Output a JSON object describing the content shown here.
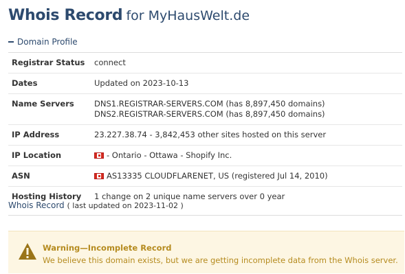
{
  "header": {
    "title": "Whois Record",
    "subtitle": "for MyHausWelt.de"
  },
  "section": {
    "toggle_label": "Domain Profile"
  },
  "profile": {
    "rows": [
      {
        "label": "Registrar Status",
        "values": [
          "connect"
        ]
      },
      {
        "label": "Dates",
        "values": [
          "Updated on 2023-10-13"
        ]
      },
      {
        "label": "Name Servers",
        "values": [
          "DNS1.REGISTRAR-SERVERS.COM (has 8,897,450 domains)",
          "DNS2.REGISTRAR-SERVERS.COM (has 8,897,450 domains)"
        ]
      },
      {
        "label": "IP Address",
        "values": [
          "23.227.38.74 - 3,842,453 other sites hosted on this server"
        ]
      },
      {
        "label": "IP Location",
        "values": [
          "- Ontario - Ottawa - Shopify Inc."
        ],
        "flag": "canada-flag-icon"
      },
      {
        "label": "ASN",
        "values": [
          "AS13335 CLOUDFLARENET, US (registered Jul 14, 2010)"
        ],
        "flag": "canada-flag-icon"
      },
      {
        "label": "Hosting History",
        "values": [
          "1 change on 2 unique name servers over 0 year"
        ]
      }
    ]
  },
  "whois": {
    "link_label": "Whois Record",
    "updated_text": "( last updated on 2023-11-02 )"
  },
  "warning": {
    "icon": "warning-triangle-icon",
    "title": "Warning—Incomplete Record",
    "text": "We believe this domain exists, but we are getting incomplete data from the Whois server."
  },
  "colors": {
    "heading": "#2d4a6e",
    "warning_text": "#b58b1f",
    "warning_bg": "#fdf6e3"
  }
}
